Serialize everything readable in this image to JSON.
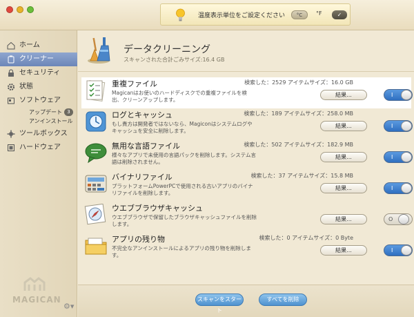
{
  "notice": {
    "text": "温度表示単位をご設定ください",
    "celsius": "°C",
    "fahrenheit": "°F",
    "confirm": "✓"
  },
  "sidebar": {
    "items": [
      {
        "label": "ホーム",
        "icon": "home-icon"
      },
      {
        "label": "クリーナー",
        "icon": "cleaner-icon"
      },
      {
        "label": "セキュリティ",
        "icon": "lock-icon"
      },
      {
        "label": "状態",
        "icon": "gear-icon"
      },
      {
        "label": "ソフトウェア",
        "icon": "software-icon"
      },
      {
        "label": "ツールボックス",
        "icon": "toolbox-icon"
      },
      {
        "label": "ハードウェア",
        "icon": "hardware-icon"
      }
    ],
    "sub_items": [
      {
        "label": "アップデート",
        "badge": "3"
      },
      {
        "label": "アンインストール"
      }
    ],
    "logo": "MAGICAN",
    "settings_glyph": "⚙▾"
  },
  "main": {
    "title": "データクリーニング",
    "subtitle": "スキャンされた合計ごみサイズ:16.4 GB",
    "rows": [
      {
        "title": "重複ファイル",
        "desc": "Magicanはお使いのハードディスクでの重複ファイルを検出、クリーンアップします。",
        "stat": "検索した：2529 アイテムサイズ：16.0 GB",
        "button": "結果...",
        "enabled": true,
        "toggle_mark": "I"
      },
      {
        "title": "ログとキャッシュ",
        "desc": "もし貴方は開発者ではないなら、Magiconはシステムログやキャッシュを安全に削除します。",
        "stat": "検索した：189 アイテムサイズ：258.0 MB",
        "button": "結果...",
        "enabled": true,
        "toggle_mark": "I"
      },
      {
        "title": "無用な言語ファイル",
        "desc": "様々なアプリで未使用の言語パックを削除します。システム言語は削除されません。",
        "stat": "検索した：502 アイテムサイズ：182.9 MB",
        "button": "結果...",
        "enabled": true,
        "toggle_mark": "I"
      },
      {
        "title": "バイナリファイル",
        "desc": "プラットフォームPowerPCで使用される古いアプリのバイナリファイルを削除します。",
        "stat": "検索した：37 アイテムサイズ：15.8 MB",
        "button": "結果...",
        "enabled": true,
        "toggle_mark": "I"
      },
      {
        "title": "ウエブブラウザキャッシュ",
        "desc": "ウエブブラウザで保留したブラウザキャッシュファイルを削除します。",
        "stat": "",
        "button": "結果...",
        "enabled": false,
        "toggle_mark": "O"
      },
      {
        "title": "アプリの残り物",
        "desc": "不完全なアンインストールによるアプリの残り物を削除します。",
        "stat": "検索した：0 アイテムサイズ：0 Byte",
        "button": "結果...",
        "enabled": true,
        "toggle_mark": "I"
      }
    ]
  },
  "footer": {
    "scan_button": "スキャンをスタート",
    "delete_button": "すべてを削除"
  },
  "colors": {
    "accent": "#3f7fca",
    "sidebar_active": "#7d95c3",
    "background": "#efe6d0"
  }
}
